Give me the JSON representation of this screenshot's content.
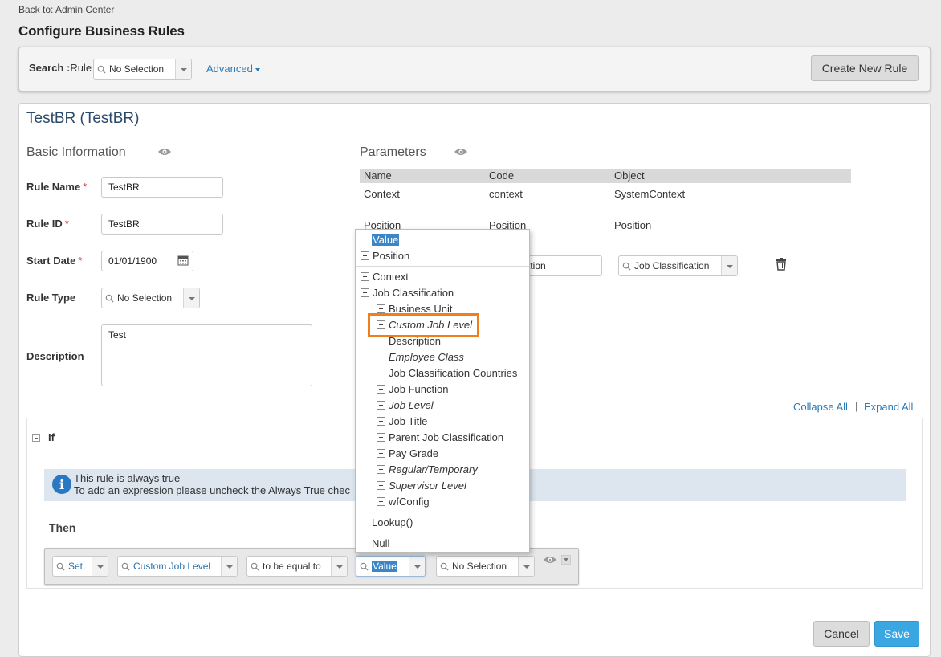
{
  "header": {
    "back_link": "Back to: Admin Center",
    "title": "Configure Business Rules"
  },
  "search": {
    "label_bold": "Search :",
    "label_rest": "Rule",
    "rule_select": "No Selection",
    "advanced": "Advanced",
    "create_button": "Create New Rule"
  },
  "rule": {
    "title": "TestBR (TestBR)",
    "basic_info": {
      "heading": "Basic Information",
      "rule_name_label": "Rule Name",
      "rule_name": "TestBR",
      "rule_id_label": "Rule ID",
      "rule_id": "TestBR",
      "start_date_label": "Start Date",
      "start_date": "01/01/1900",
      "rule_type_label": "Rule Type",
      "rule_type": "No Selection",
      "description_label": "Description",
      "description": "Test",
      "required_mark": "*"
    },
    "parameters": {
      "heading": "Parameters",
      "columns": [
        "Name",
        "Code",
        "Object"
      ],
      "rows": [
        [
          "Context",
          "context",
          "SystemContext"
        ],
        [
          "Position",
          "Position",
          "Position"
        ]
      ],
      "new_param_code": "sification",
      "new_param_object": "Job Classification"
    },
    "collapse_all": "Collapse All",
    "separator": "|",
    "expand_all": "Expand All",
    "if_section": {
      "label": "If",
      "info_line1": "This rule is always true",
      "info_line2": "To add an expression please uncheck the Always True chec"
    },
    "then_section": {
      "label": "Then",
      "action": "Set",
      "field": "Custom Job Level",
      "operator": "to be equal to",
      "value_type": "Value",
      "value": "No Selection"
    }
  },
  "dropdown": {
    "value": "Value",
    "position": "Position",
    "context": "Context",
    "job_classification": "Job Classification",
    "children": [
      {
        "label": "Business Unit",
        "italic": false
      },
      {
        "label": "Custom Job Level",
        "italic": true
      },
      {
        "label": "Description",
        "italic": false
      },
      {
        "label": "Employee Class",
        "italic": true
      },
      {
        "label": "Job Classification Countries",
        "italic": false
      },
      {
        "label": "Job Function",
        "italic": false
      },
      {
        "label": "Job Level",
        "italic": true
      },
      {
        "label": "Job Title",
        "italic": false
      },
      {
        "label": "Parent Job Classification",
        "italic": false
      },
      {
        "label": "Pay Grade",
        "italic": false
      },
      {
        "label": "Regular/Temporary",
        "italic": true
      },
      {
        "label": "Supervisor Level",
        "italic": true
      },
      {
        "label": "wfConfig",
        "italic": false
      }
    ],
    "lookup": "Lookup()",
    "null": "Null"
  },
  "footer": {
    "cancel": "Cancel",
    "save": "Save"
  },
  "colors": {
    "accent": "#3aa7e3",
    "link": "#2a7ab8",
    "highlight_frame": "#f07f1b"
  }
}
